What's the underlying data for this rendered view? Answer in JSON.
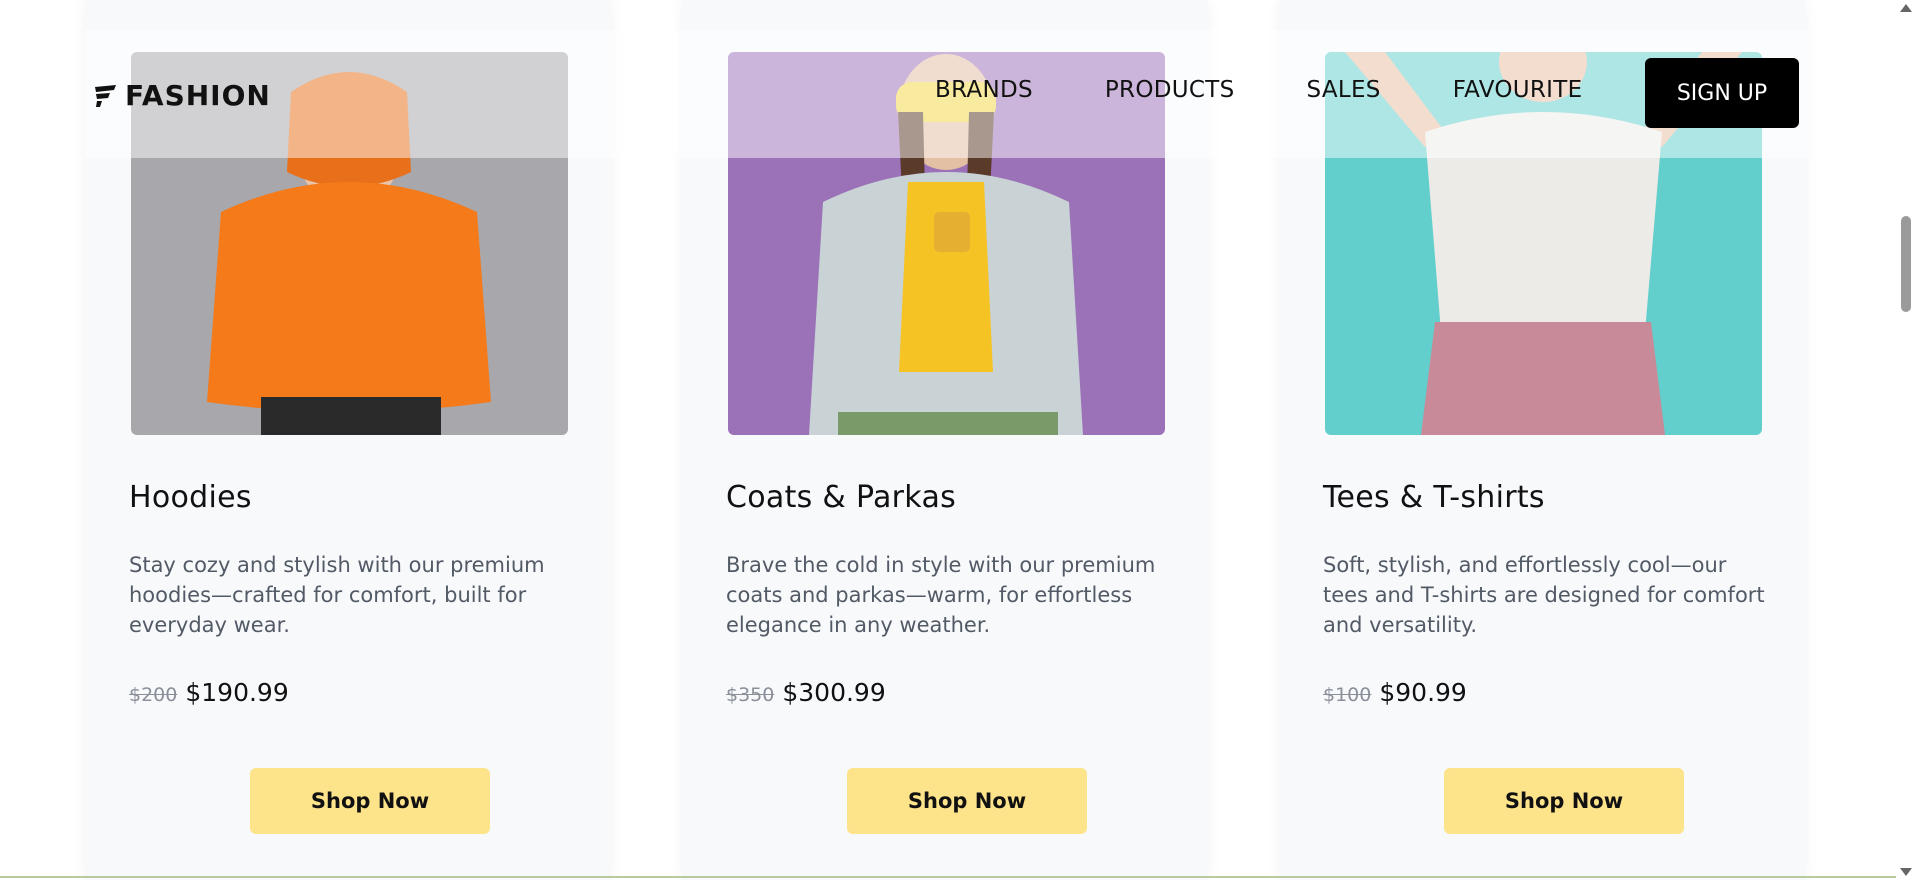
{
  "header": {
    "logo_text": "FASHION",
    "nav": [
      "BRANDS",
      "PRODUCTS",
      "SALES",
      "FAVOURITE"
    ],
    "signup_label": "SIGN UP"
  },
  "products": [
    {
      "title": "Hoodies",
      "description": "Stay cozy and stylish with our premium hoodies—crafted for comfort, built for everyday wear.",
      "old_price": "$200",
      "new_price": "$190.99",
      "button": "Shop Now",
      "image_bg": "#a8a7ab",
      "garment_color": "#f47a1a"
    },
    {
      "title": "Coats & Parkas",
      "description": "Brave the cold in style with our premium coats and parkas—warm, for effortless elegance in any weather.",
      "old_price": "$350",
      "new_price": "$300.99",
      "button": "Shop Now",
      "image_bg": "#9b71b8",
      "garment_color": "#c9d3d6"
    },
    {
      "title": "Tees & T-shirts",
      "description": "Soft, stylish, and effortlessly cool—our tees and T-shirts are designed for comfort and versatility.",
      "old_price": "$100",
      "new_price": "$90.99",
      "button": "Shop Now",
      "image_bg": "#63cfcc",
      "garment_color": "#ecebe8"
    }
  ]
}
